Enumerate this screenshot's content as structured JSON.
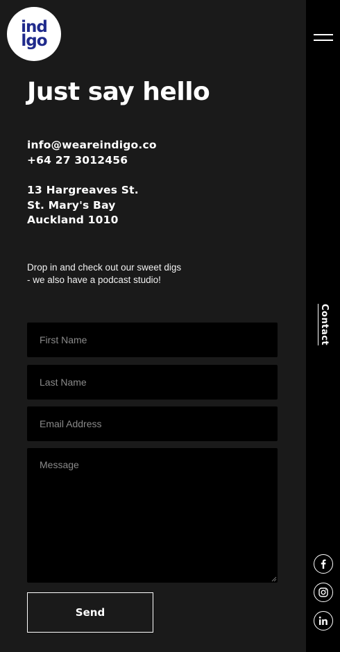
{
  "brand": {
    "logo_text": "ind\nlgo",
    "brand_color": "#1f2a8c"
  },
  "heading": "Just say hello",
  "contact": {
    "email": "info@weareindigo.co",
    "phone": "+64 27 3012456",
    "address": [
      "13 Hargreaves St.",
      "St. Mary's Bay",
      "Auckland 1010"
    ]
  },
  "description": "Drop in and check out our sweet digs - we also have a podcast studio!",
  "form": {
    "first_name_placeholder": "First Name",
    "last_name_placeholder": "Last Name",
    "email_placeholder": "Email Address",
    "message_placeholder": "Message",
    "send_label": "Send"
  },
  "rail": {
    "menu_icon": "hamburger-icon",
    "section_label": "Contact",
    "social": [
      {
        "name": "facebook-icon"
      },
      {
        "name": "instagram-icon"
      },
      {
        "name": "linkedin-icon"
      }
    ]
  },
  "colors": {
    "page_bg": "#1a1a1a",
    "rail_bg": "#000000",
    "field_bg": "#000000",
    "text": "#ffffff"
  }
}
